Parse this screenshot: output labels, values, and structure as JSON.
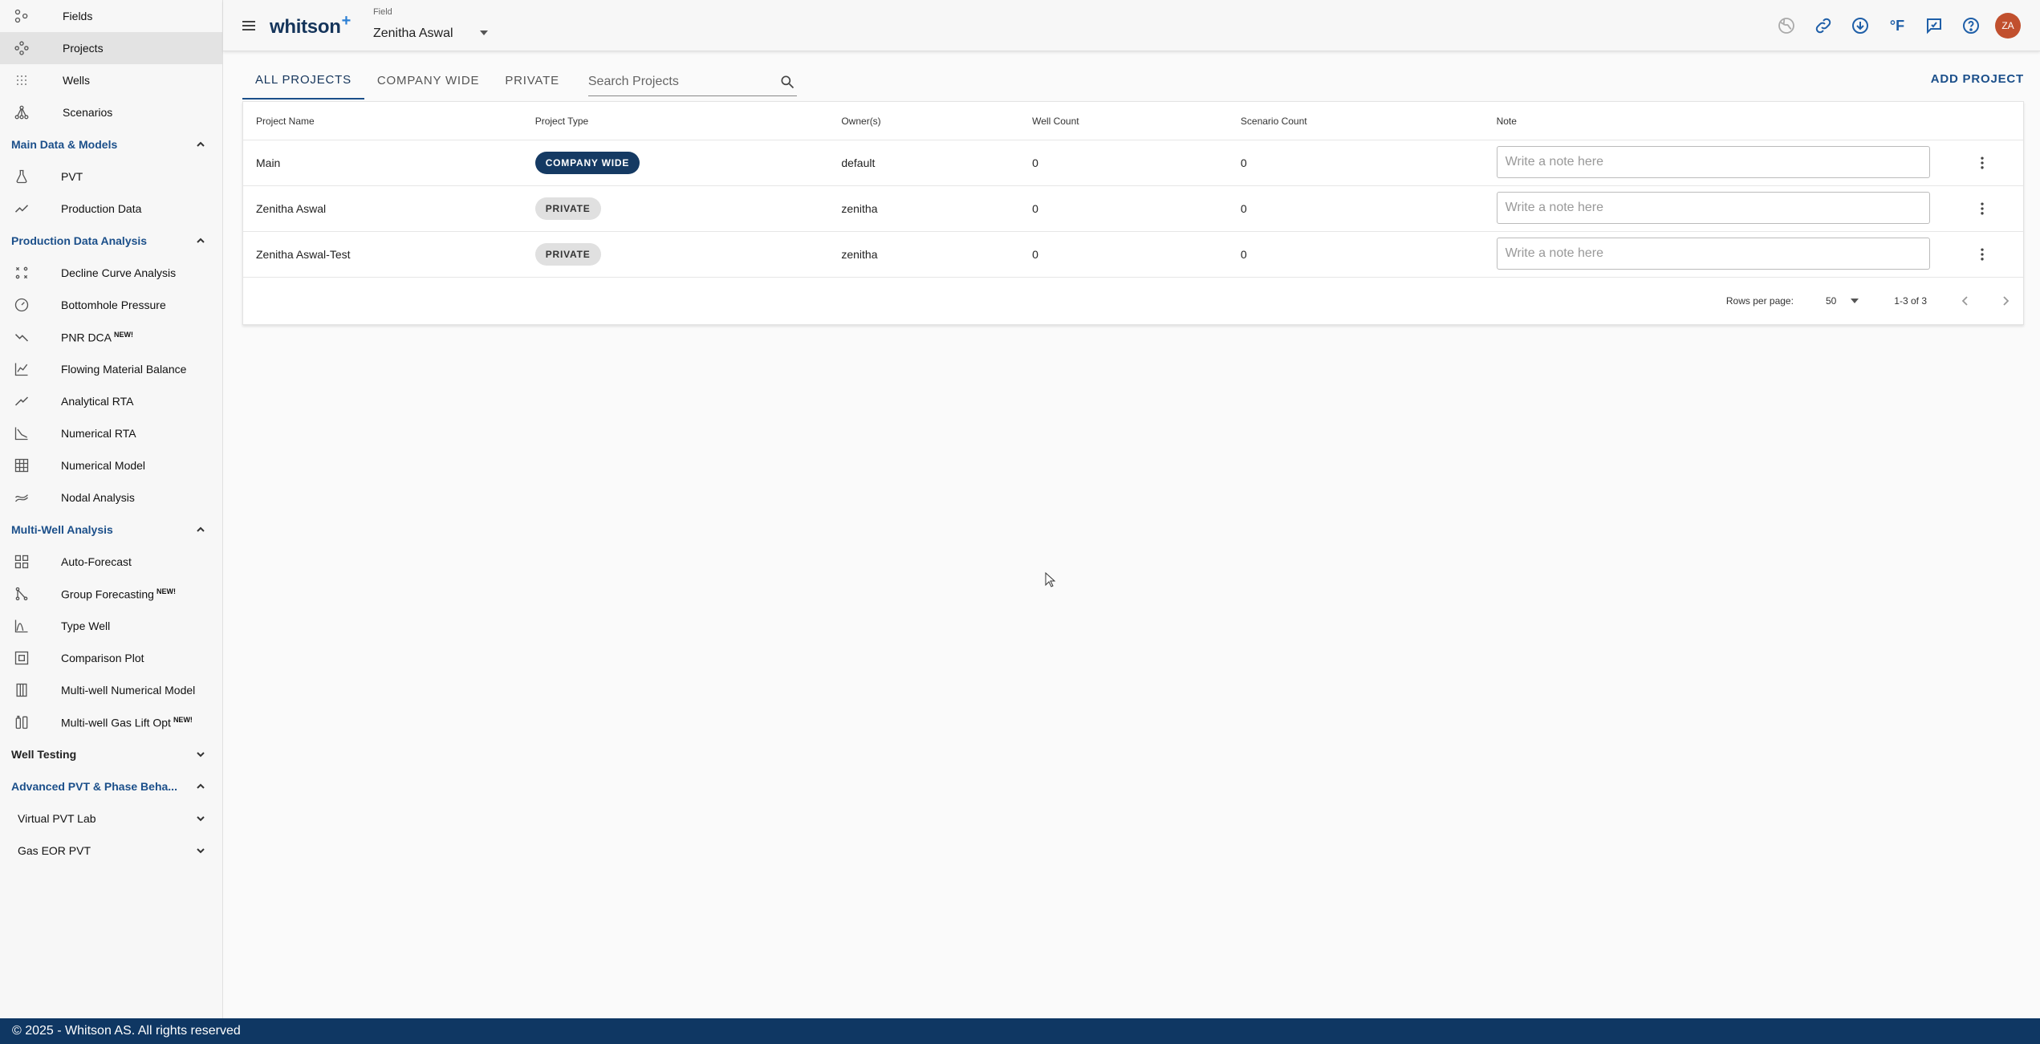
{
  "sidebar": {
    "top_items": [
      {
        "label": "Fields",
        "icon": "fields-icon"
      },
      {
        "label": "Projects",
        "icon": "projects-icon",
        "active": true
      },
      {
        "label": "Wells",
        "icon": "wells-icon"
      },
      {
        "label": "Scenarios",
        "icon": "scenarios-icon"
      }
    ],
    "sections": {
      "main_data": {
        "title": "Main Data & Models",
        "items": [
          "PVT",
          "Production Data"
        ]
      },
      "pda": {
        "title": "Production Data Analysis",
        "items": [
          "Decline Curve Analysis",
          "Bottomhole Pressure",
          "PNR DCA",
          "Flowing Material Balance",
          "Analytical RTA",
          "Numerical RTA",
          "Numerical Model",
          "Nodal Analysis"
        ]
      },
      "mwa": {
        "title": "Multi-Well Analysis",
        "items": [
          "Auto-Forecast",
          "Group Forecasting",
          "Type Well",
          "Comparison Plot",
          "Multi-well Numerical Model",
          "Multi-well Gas Lift Opt"
        ]
      },
      "well_testing": {
        "title": "Well Testing"
      },
      "advanced": {
        "title": "Advanced PVT & Phase Beha...",
        "subs": [
          "Virtual PVT Lab",
          "Gas EOR PVT"
        ]
      }
    },
    "new_badge": "NEW!"
  },
  "topbar": {
    "logo": "whitson",
    "logo_plus": "+",
    "field_label": "Field",
    "field_value": "Zenitha Aswal",
    "avatar_initials": "ZA",
    "accent_color": "#1f5fa8"
  },
  "main": {
    "tabs": [
      "ALL PROJECTS",
      "COMPANY WIDE",
      "PRIVATE"
    ],
    "search_placeholder": "Search Projects",
    "add_project": "ADD PROJECT",
    "columns": [
      "Project Name",
      "Project Type",
      "Owner(s)",
      "Well Count",
      "Scenario Count",
      "Note"
    ],
    "rows": [
      {
        "name": "Main",
        "type": "COMPANY WIDE",
        "owner": "default",
        "wells": "0",
        "scenarios": "0",
        "note_placeholder": "Write a note here"
      },
      {
        "name": "Zenitha Aswal",
        "type": "PRIVATE",
        "owner": "zenitha",
        "wells": "0",
        "scenarios": "0",
        "note_placeholder": "Write a note here"
      },
      {
        "name": "Zenitha Aswal-Test",
        "type": "PRIVATE",
        "owner": "zenitha",
        "wells": "0",
        "scenarios": "0",
        "note_placeholder": "Write a note here"
      }
    ],
    "pagination": {
      "rows_per_page_label": "Rows per page:",
      "rows_per_page": "50",
      "range": "1-3 of 3"
    }
  },
  "footer": {
    "copyright": "© 2025 - Whitson AS. All rights reserved"
  }
}
